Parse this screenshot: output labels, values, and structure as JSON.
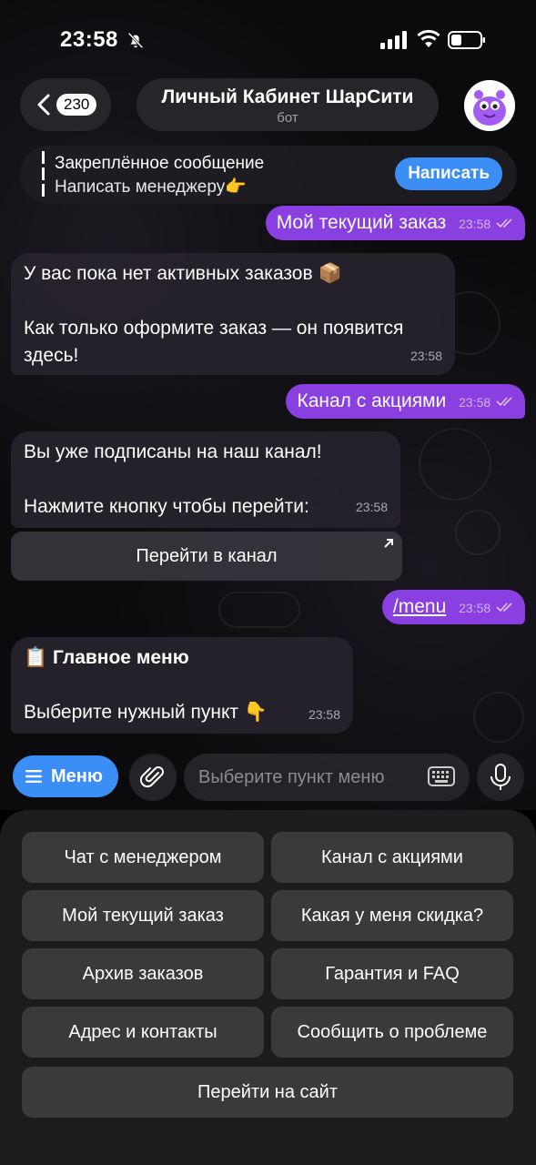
{
  "status_bar": {
    "time": "23:58"
  },
  "header": {
    "back_count": "230",
    "title": "Личный Кабинет ШарСити",
    "subtitle": "бот"
  },
  "pinned": {
    "title": "Закреплённое сообщение",
    "text": "Написать менеджеру👉",
    "button": "Написать"
  },
  "messages": [
    {
      "dir": "out",
      "text": "Мой текущий заказ",
      "time": "23:58"
    },
    {
      "dir": "in",
      "line1": "У вас пока нет активных заказов 📦",
      "line2": "Как только оформите заказ — он появится",
      "line3": "здесь!",
      "time": "23:58"
    },
    {
      "dir": "out",
      "text": "Канал с акциями",
      "time": "23:58"
    },
    {
      "dir": "in",
      "line1": "Вы уже подписаны на наш канал!",
      "line2": "Нажмите кнопку чтобы перейти:",
      "time": "23:58",
      "button": "Перейти в канал"
    },
    {
      "dir": "out",
      "text": "/menu",
      "time": "23:58"
    },
    {
      "dir": "in",
      "line1_emoji": "📋",
      "line1": "Главное меню",
      "line2": "Выберите нужный пункт 👇",
      "time": "23:58"
    }
  ],
  "composer": {
    "menu_label": "Меню",
    "placeholder": "Выберите пункт меню"
  },
  "keyboard": {
    "buttons": [
      "Чат с менеджером",
      "Канал с акциями",
      "Мой текущий заказ",
      "Какая у меня скидка?",
      "Архив заказов",
      "Гарантия и FAQ",
      "Адрес и контакты",
      "Сообщить о проблеме",
      "Перейти на сайт"
    ]
  },
  "colors": {
    "accent_blue": "#3a8ef5",
    "outgoing_bubble": "#8a3fe0",
    "incoming_bubble": "#26222c",
    "keyboard_bg": "#1c1c1e",
    "key_bg": "#3a3a3c"
  }
}
